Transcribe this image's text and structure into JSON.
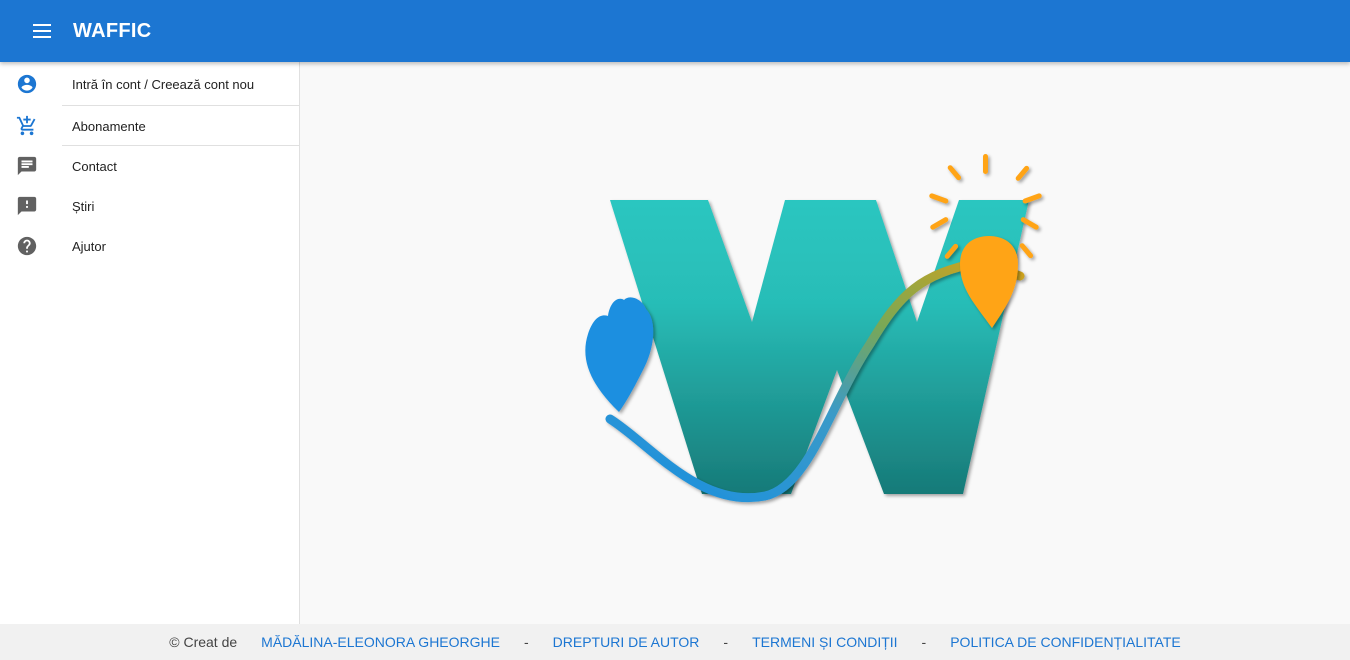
{
  "appbar": {
    "title": "WAFFIC",
    "menu_icon": "menu-icon"
  },
  "sidebar": {
    "items": [
      {
        "label": "Intră în cont / Creează cont nou",
        "icon": "account-circle-icon"
      },
      {
        "label": "Abonamente",
        "icon": "add-shopping-cart-icon"
      },
      {
        "label": "Contact",
        "icon": "message-icon"
      },
      {
        "label": "Știri",
        "icon": "feedback-icon"
      },
      {
        "label": "Ajutor",
        "icon": "help-icon"
      }
    ]
  },
  "main": {
    "logo_icon": "waffic-logo"
  },
  "footer": {
    "credit": "© Creat de",
    "author": "MĂDĂLINA-ELEONORA GHEORGHE",
    "separator": "-",
    "copyright": "DREPTURI DE AUTOR",
    "terms": "TERMENI ȘI CONDIȚII",
    "privacy": "POLITICA DE CONFIDENȚIALITATE"
  },
  "colors": {
    "appbar": "#1c76d2",
    "link": "#1c76d2",
    "logo_teal": "#28c2bc",
    "logo_sun": "#ffa414",
    "logo_drop": "#1a8fe0"
  }
}
